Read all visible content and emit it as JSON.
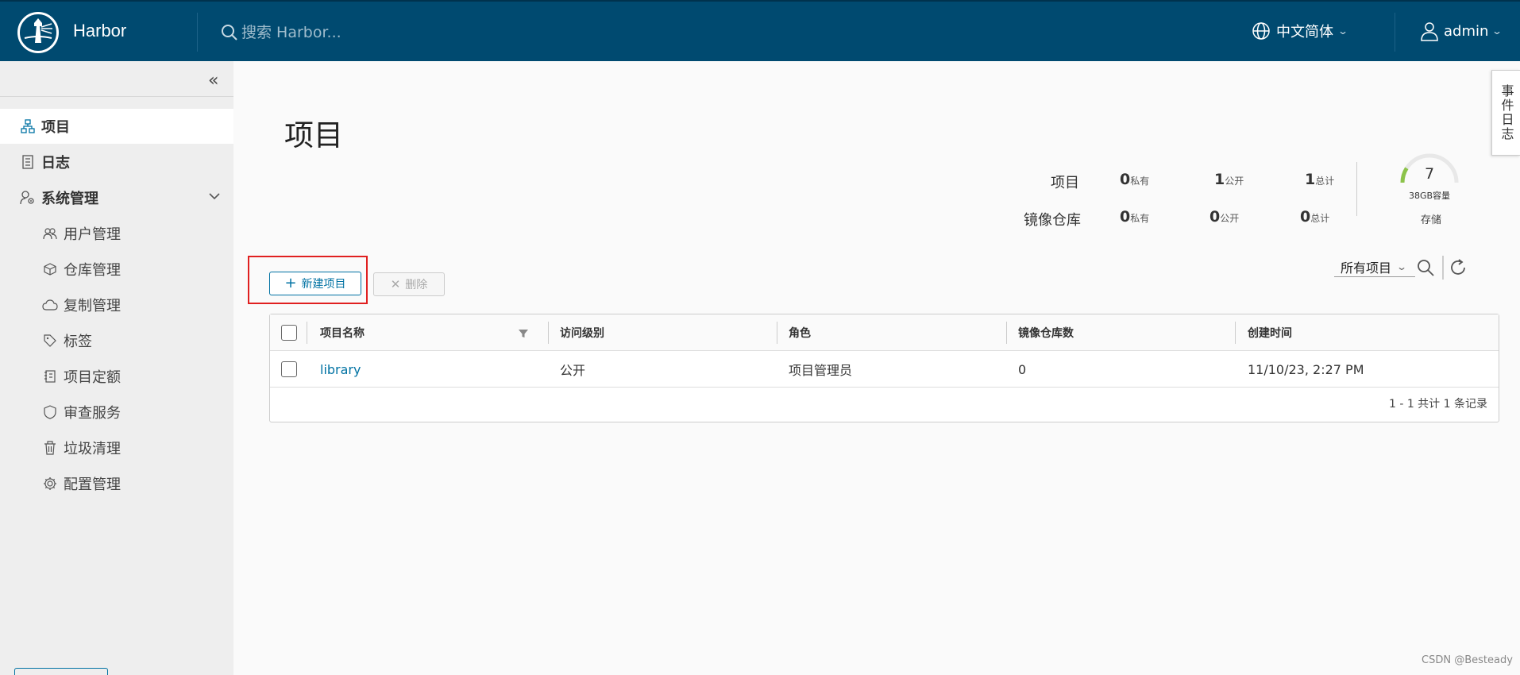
{
  "header": {
    "brand": "Harbor",
    "search_placeholder": "搜索 Harbor...",
    "language": "中文简体",
    "user": "admin",
    "bg_color": "#004a70"
  },
  "sidebar": {
    "collapse_icon": "double-chevron-left-icon",
    "items": [
      {
        "label": "项目",
        "icon": "project-icon",
        "active": true
      },
      {
        "label": "日志",
        "icon": "log-icon"
      },
      {
        "label": "系统管理",
        "icon": "admin-icon",
        "expanded": true
      }
    ],
    "sub_items": [
      {
        "label": "用户管理",
        "icon": "users-icon"
      },
      {
        "label": "仓库管理",
        "icon": "box-icon"
      },
      {
        "label": "复制管理",
        "icon": "cloud-icon"
      },
      {
        "label": "标签",
        "icon": "tag-icon"
      },
      {
        "label": "项目定额",
        "icon": "quota-icon"
      },
      {
        "label": "审查服务",
        "icon": "shield-icon"
      },
      {
        "label": "垃圾清理",
        "icon": "trash-icon"
      },
      {
        "label": "配置管理",
        "icon": "gear-icon"
      }
    ]
  },
  "main": {
    "title": "项目",
    "stats": {
      "projects_label": "项目",
      "repos_label": "镜像仓库",
      "projects": {
        "private": "0",
        "public": "1",
        "total": "1"
      },
      "repos": {
        "private": "0",
        "public": "0",
        "total": "0"
      },
      "private_suffix": "私有",
      "public_suffix": "公开",
      "total_suffix": "总计"
    },
    "storage": {
      "value": "7",
      "capacity": "38GB容量",
      "label": "存储",
      "fraction": 0.18
    },
    "toolbar": {
      "new_project": "新建项目",
      "delete": "删除",
      "filter_value": "所有项目"
    },
    "table": {
      "columns": [
        "项目名称",
        "访问级别",
        "角色",
        "镜像仓库数",
        "创建时间"
      ],
      "rows": [
        {
          "name": "library",
          "access": "公开",
          "role": "项目管理员",
          "repo_count": "0",
          "created": "11/10/23, 2:27 PM"
        }
      ],
      "footer": "1 - 1 共计 1 条记录"
    }
  },
  "side_tab": "事件日志",
  "watermark": "CSDN @Besteady"
}
